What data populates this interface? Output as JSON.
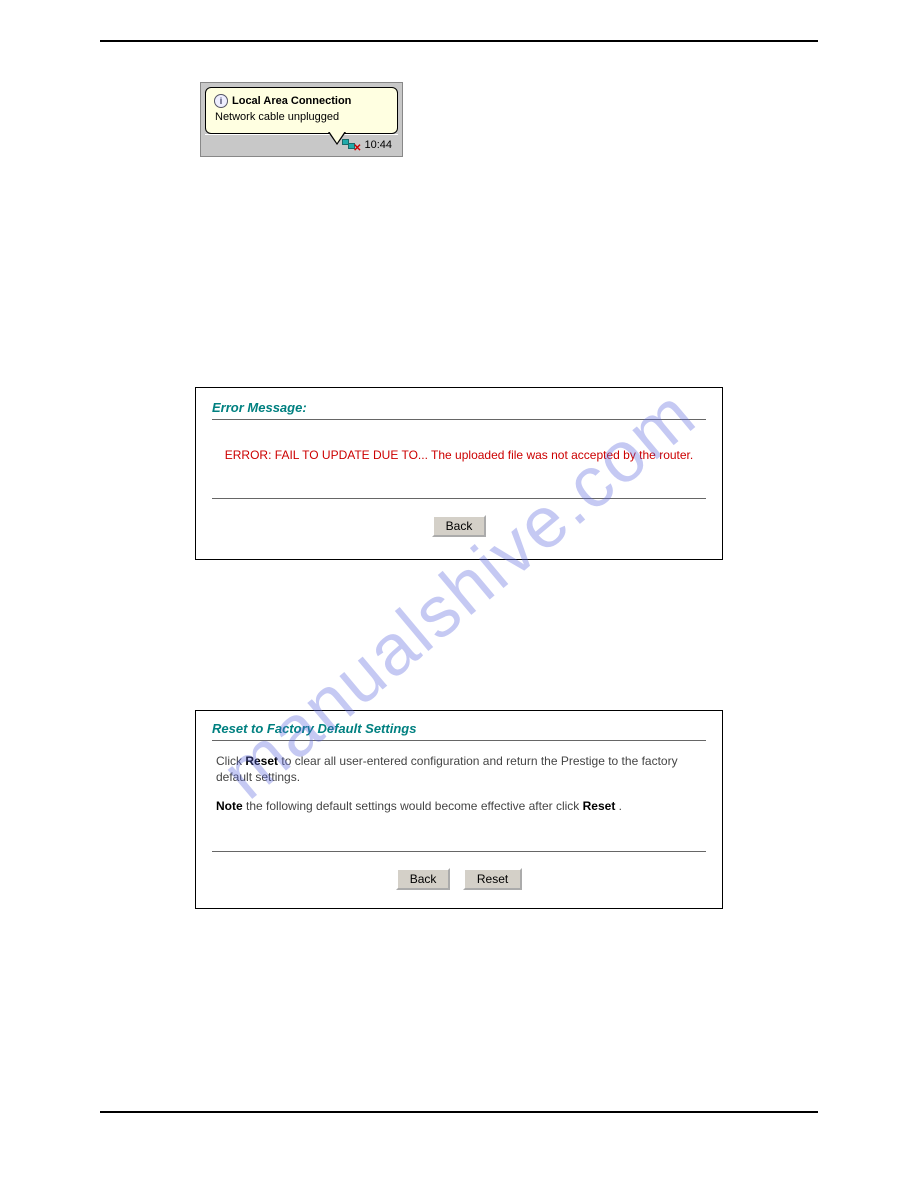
{
  "watermark": "manualshive.com",
  "tooltip": {
    "title": "Local Area Connection",
    "subtitle": "Network cable unplugged",
    "clock": "10:44"
  },
  "error_panel": {
    "heading": "Error Message:",
    "message": "ERROR: FAIL TO UPDATE DUE TO... The uploaded file was not accepted by the router.",
    "back_label": "Back"
  },
  "reset_panel": {
    "heading": "Reset to Factory Default Settings",
    "line1_pre": "Click ",
    "line1_bold": "Reset",
    "line1_post": " to clear all user-entered configuration and return the Prestige to the factory default settings.",
    "line2_bold": "Note",
    "line2_mid": " the following default settings would become effective after click ",
    "line2_bold2": "Reset",
    "line2_end": " .",
    "back_label": "Back",
    "reset_label": "Reset"
  }
}
